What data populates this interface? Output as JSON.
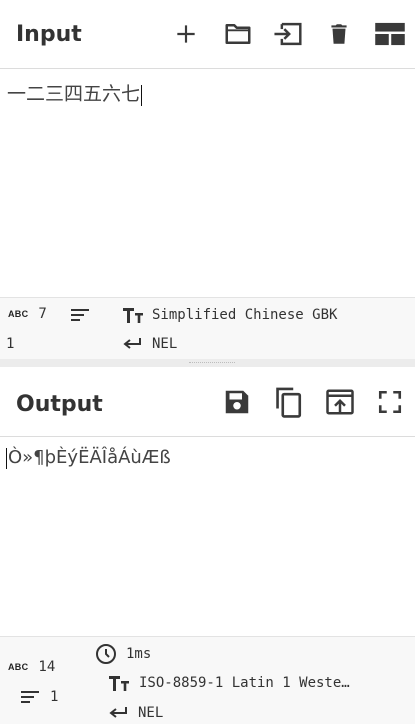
{
  "input": {
    "title": "Input",
    "text": "一二三四五六七",
    "stats": {
      "length": "7",
      "lines": "1",
      "encoding": "Simplified Chinese GBK",
      "eol": "NEL"
    }
  },
  "output": {
    "title": "Output",
    "text": "Ò»¶þÈýËÄÎåÁùÆß",
    "stats": {
      "length": "14",
      "lines": "1",
      "time": "1ms",
      "encoding": "ISO-8859-1 Latin 1 Weste…",
      "eol": "NEL"
    }
  },
  "icons": {
    "input": [
      "add-icon",
      "open-folder-icon",
      "import-icon",
      "delete-icon",
      "layout-icon"
    ],
    "output": [
      "save-icon",
      "copy-icon",
      "replace-input-icon",
      "fullscreen-icon"
    ]
  }
}
